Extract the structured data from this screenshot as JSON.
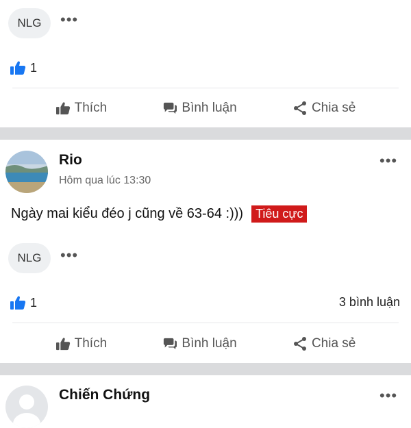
{
  "post1": {
    "reaction_pill": "NLG",
    "more": "•••",
    "like_count": "1",
    "actions": {
      "like": "Thích",
      "comment": "Bình luận",
      "share": "Chia sẻ"
    }
  },
  "post2": {
    "author": "Rio",
    "timestamp": "Hôm qua lúc 13:30",
    "text": "Ngày mai kiểu đéo j cũng về 63-64 :)))",
    "sentiment_badge": "Tiêu cực",
    "reaction_pill": "NLG",
    "more": "•••",
    "menu": "•••",
    "like_count": "1",
    "comment_count": "3 bình luận",
    "actions": {
      "like": "Thích",
      "comment": "Bình luận",
      "share": "Chia sẻ"
    }
  },
  "post3": {
    "author": "Chiến Chứng",
    "menu": "•••"
  },
  "colors": {
    "accent": "#1877f2",
    "badge": "#d01a1a",
    "separator": "#dadbdd"
  }
}
